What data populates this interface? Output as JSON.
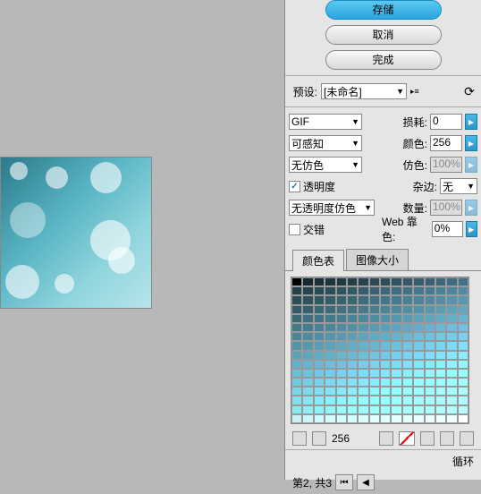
{
  "buttons": {
    "save": "存储",
    "cancel": "取消",
    "done": "完成"
  },
  "preset": {
    "label": "预设:",
    "value": "[未命名]"
  },
  "format": {
    "value": "GIF",
    "lossy_label": "损耗:",
    "lossy_value": "0",
    "palette": "可感知",
    "colors_label": "颜色:",
    "colors_value": "256",
    "dither": "无仿色",
    "dither_label": "仿色:",
    "dither_value": "100%",
    "transparency_label": "透明度",
    "transparency_checked": true,
    "matte_label": "杂边:",
    "matte_value": "无",
    "trans_dither": "无透明度仿色",
    "amount_label": "数量:",
    "amount_value": "100%",
    "interlace_label": "交错",
    "interlace_checked": false,
    "websnap_label": "Web 靠色:",
    "websnap_value": "0%"
  },
  "tabs": {
    "color_table": "颜色表",
    "image_size": "图像大小"
  },
  "color_table": {
    "count": "256",
    "colors": [
      "#000000",
      "#162a30",
      "#1a3038",
      "#1d353e",
      "#203a44",
      "#233f4a",
      "#264450",
      "#294956",
      "#2c4e5c",
      "#2f5362",
      "#325868",
      "#355d6e",
      "#386274",
      "#3b677a",
      "#3e6c80",
      "#417186",
      "#224048",
      "#25454e",
      "#284a54",
      "#2b4f5a",
      "#2e5460",
      "#315966",
      "#345e6c",
      "#376372",
      "#3a6878",
      "#3d6d7e",
      "#407284",
      "#43778a",
      "#467c90",
      "#498196",
      "#4c869c",
      "#4f8ba2",
      "#2a4e58",
      "#2d535e",
      "#305864",
      "#335d6a",
      "#366270",
      "#396776",
      "#3c6c7c",
      "#3f7182",
      "#427688",
      "#457b8e",
      "#488094",
      "#4b859a",
      "#4e8aa0",
      "#518fa6",
      "#5494ac",
      "#5799b2",
      "#325c68",
      "#35616e",
      "#386674",
      "#3b6b7a",
      "#3e7080",
      "#417586",
      "#447a8c",
      "#477f92",
      "#4a8498",
      "#4d899e",
      "#508ea4",
      "#5393aa",
      "#5698b0",
      "#599db6",
      "#5ca2bc",
      "#5fa7c2",
      "#3a6a78",
      "#3d6f7e",
      "#407484",
      "#43798a",
      "#467e90",
      "#498396",
      "#4c889c",
      "#4f8da2",
      "#5292a8",
      "#5597ae",
      "#589cb4",
      "#5ba1ba",
      "#5ea6c0",
      "#61abc6",
      "#64b0cc",
      "#67b5d2",
      "#427888",
      "#457d8e",
      "#488294",
      "#4b879a",
      "#4e8ca0",
      "#5191a6",
      "#5496ac",
      "#579bb2",
      "#5aa0b8",
      "#5da5be",
      "#60aac4",
      "#63afca",
      "#66b4d0",
      "#69b9d6",
      "#6cbedc",
      "#6fc3e2",
      "#4a8698",
      "#4d8b9e",
      "#5090a4",
      "#5395aa",
      "#569ab0",
      "#599fb6",
      "#5ca4bc",
      "#5fa9c2",
      "#62aec8",
      "#65b3ce",
      "#68b8d4",
      "#6bbdda",
      "#6ec2e0",
      "#71c7e6",
      "#74ccec",
      "#77d1f2",
      "#5294a8",
      "#5599ae",
      "#589eb4",
      "#5ba3ba",
      "#5ea8c0",
      "#61adc6",
      "#64b2cc",
      "#67b7d2",
      "#6abcd8",
      "#6dc1de",
      "#70c6e4",
      "#73cbea",
      "#76d0f0",
      "#79d5f6",
      "#7cdafc",
      "#7fdfff",
      "#5aa2b8",
      "#5da7be",
      "#60acc4",
      "#63b1ca",
      "#66b6d0",
      "#69bbd6",
      "#6cc0dc",
      "#6fc5e2",
      "#72cae8",
      "#75cfee",
      "#78d4f4",
      "#7bd9fa",
      "#7edeff",
      "#81e3ff",
      "#84e8ff",
      "#87edff",
      "#62b0c8",
      "#65b5ce",
      "#68bad4",
      "#6bbfda",
      "#6ec4e0",
      "#71c9e6",
      "#74ceec",
      "#77d3f2",
      "#7ad8f8",
      "#7dddfe",
      "#80e2ff",
      "#83e7ff",
      "#86ecff",
      "#89f1ff",
      "#8cf6ff",
      "#8ffbff",
      "#6abed8",
      "#6dc3de",
      "#70c8e4",
      "#73cdea",
      "#76d2f0",
      "#79d7f6",
      "#7cdcfc",
      "#7fe1ff",
      "#82e6ff",
      "#85ebff",
      "#88f0ff",
      "#8bf5ff",
      "#8efaff",
      "#91ffff",
      "#94ffff",
      "#97ffff",
      "#72cae0",
      "#75cfe6",
      "#78d4ec",
      "#7bd9f2",
      "#7edef8",
      "#81e3fe",
      "#84e8ff",
      "#87edff",
      "#8af2ff",
      "#8df7ff",
      "#90fcff",
      "#93ffff",
      "#96ffff",
      "#99ffff",
      "#9cffff",
      "#9fffff",
      "#7ad6e8",
      "#7ddbee",
      "#80e0f4",
      "#83e5fa",
      "#86eaff",
      "#89efff",
      "#8cf4ff",
      "#8ff9ff",
      "#92feff",
      "#95ffff",
      "#98ffff",
      "#9bffff",
      "#9effff",
      "#a1ffff",
      "#a4ffff",
      "#a7ffff",
      "#82e0ee",
      "#85e5f4",
      "#88eafa",
      "#8beffe",
      "#8ef4ff",
      "#91f9ff",
      "#94feff",
      "#97ffff",
      "#9affff",
      "#9dffff",
      "#a0ffff",
      "#a3ffff",
      "#a6ffff",
      "#a9ffff",
      "#acffff",
      "#afffff",
      "#8ae8f2",
      "#8dedf8",
      "#90f2fe",
      "#93f7ff",
      "#96fcff",
      "#99ffff",
      "#9cffff",
      "#9fffff",
      "#a2ffff",
      "#a5ffff",
      "#a8ffff",
      "#abffff",
      "#aeffff",
      "#b1ffff",
      "#b4ffff",
      "#b7ffff",
      "#c8f0f5",
      "#cbf5fb",
      "#cefafe",
      "#d1ffff",
      "#d4ffff",
      "#d7ffff",
      "#daffff",
      "#ddffff",
      "#e0ffff",
      "#e3ffff",
      "#e6ffff",
      "#e9ffff",
      "#ecffff",
      "#efffff",
      "#f2ffff",
      "#ffffff"
    ]
  },
  "loop": {
    "label": "循环"
  },
  "nav": {
    "frame_info": "第2, 共3"
  }
}
